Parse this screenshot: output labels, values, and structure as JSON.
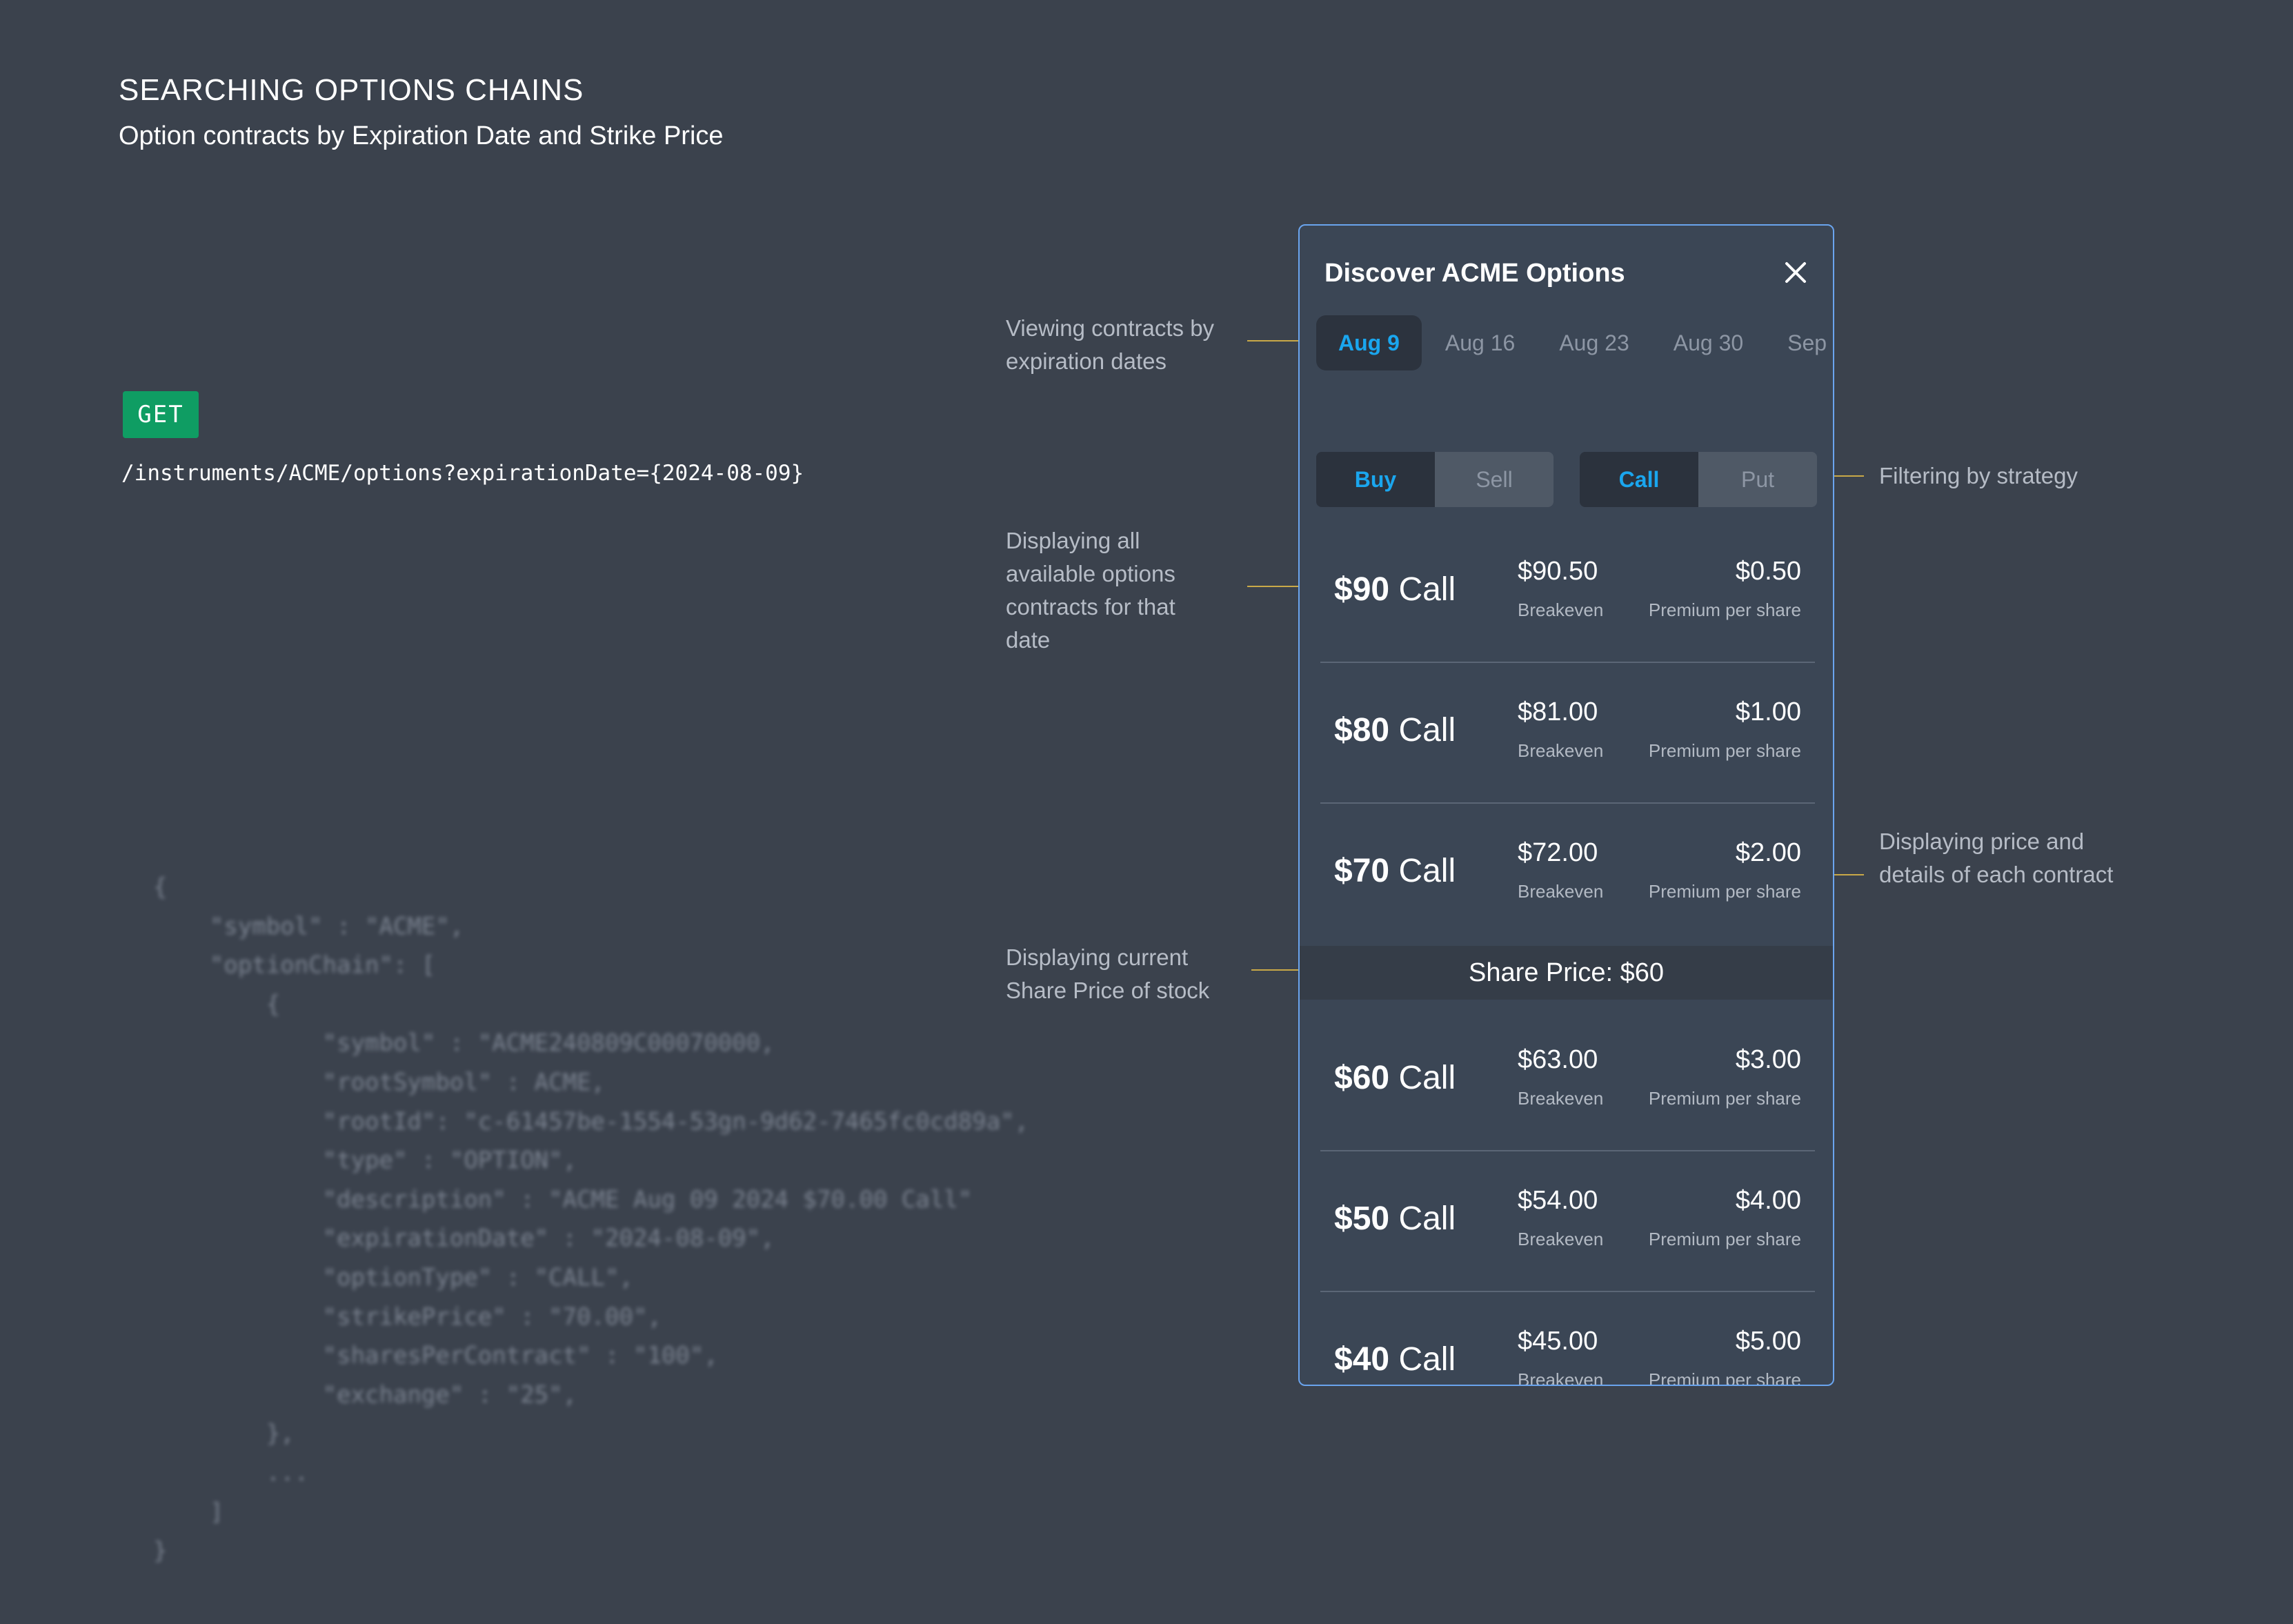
{
  "header": {
    "title": "SEARCHING OPTIONS CHAINS",
    "subtitle": "Option contracts by Expiration Date and Strike Price"
  },
  "request": {
    "method": "GET",
    "endpoint": "/instruments/ACME/options?expirationDate={2024-08-09}"
  },
  "response_json": [
    "{",
    "    \"symbol\" : \"ACME\",",
    "    \"optionChain\": [",
    "        {",
    "            \"symbol\" : \"ACME240809C00070000,",
    "            \"rootSymbol\" : ACME,",
    "            \"rootId\": \"c-61457be-1554-53gn-9d62-7465fc0cd89a\",",
    "            \"type\" : \"OPTION\",",
    "            \"description\" : \"ACME Aug 09 2024 $70.00 Call\"",
    "            \"expirationDate\" : \"2024-08-09\",",
    "            \"optionType\" : \"CALL\",",
    "            \"strikePrice\" : \"70.00\",",
    "            \"sharesPerContract\" : \"100\",",
    "            \"exchange\" : \"25\",",
    "        },",
    "        ...",
    "    ]",
    "}"
  ],
  "annotations": {
    "expiration": "Viewing contracts by expiration dates",
    "contracts": "Displaying all available options contracts for that date",
    "share_price": "Displaying current Share Price of stock",
    "strategy": "Filtering by strategy",
    "details": "Displaying price and details of each contract"
  },
  "panel": {
    "title": "Discover ACME Options",
    "close_icon": "close-icon",
    "date_tabs": [
      "Aug 9",
      "Aug 16",
      "Aug 23",
      "Aug 30",
      "Sep"
    ],
    "active_date": "Aug 9",
    "side_toggle": [
      "Buy",
      "Sell"
    ],
    "type_toggle": [
      "Call",
      "Put"
    ],
    "accent_color": "#1aa6ee",
    "border_color": "#6aa4ee",
    "share_price": "Share Price: $60",
    "contracts_above": [
      {
        "strike": "$90",
        "type": "Call",
        "breakeven": "$90.50",
        "breakeven_label": "Breakeven",
        "premium": "$0.50",
        "premium_label": "Premium per share"
      },
      {
        "strike": "$80",
        "type": "Call",
        "breakeven": "$81.00",
        "breakeven_label": "Breakeven",
        "premium": "$1.00",
        "premium_label": "Premium per share"
      },
      {
        "strike": "$70",
        "type": "Call",
        "breakeven": "$72.00",
        "breakeven_label": "Breakeven",
        "premium": "$2.00",
        "premium_label": "Premium per share"
      }
    ],
    "contracts_below": [
      {
        "strike": "$60",
        "type": "Call",
        "breakeven": "$63.00",
        "breakeven_label": "Breakeven",
        "premium": "$3.00",
        "premium_label": "Premium per share"
      },
      {
        "strike": "$50",
        "type": "Call",
        "breakeven": "$54.00",
        "breakeven_label": "Breakeven",
        "premium": "$4.00",
        "premium_label": "Premium per share"
      },
      {
        "strike": "$40",
        "type": "Call",
        "breakeven": "$45.00",
        "breakeven_label": "Breakeven",
        "premium": "$5.00",
        "premium_label": "Premium per share"
      }
    ]
  }
}
